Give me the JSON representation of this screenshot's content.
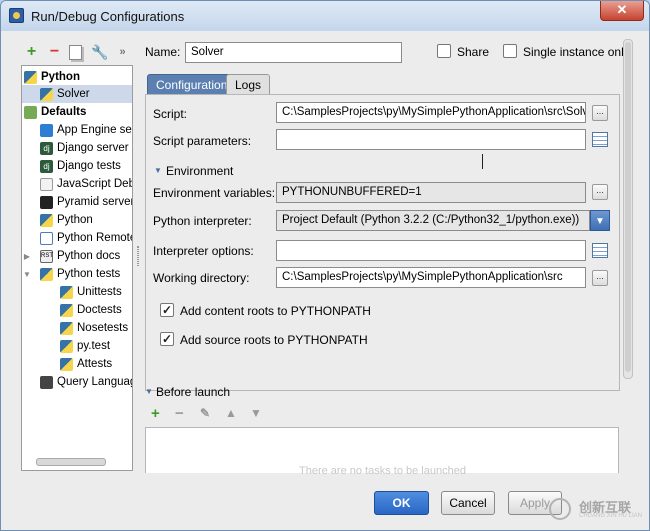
{
  "window": {
    "title": "Run/Debug Configurations",
    "close_label": "✕"
  },
  "toolbar": {
    "add": "+",
    "remove": "−",
    "more": "»"
  },
  "tree": {
    "python_group": "Python",
    "solver": "Solver",
    "defaults": "Defaults",
    "items": [
      "App Engine serv",
      "Django server",
      "Django tests",
      "JavaScript Debu",
      "Pyramid server",
      "Python",
      "Python Remote",
      "Python docs",
      "Python tests"
    ],
    "python_tests_children": [
      "Unittests",
      "Doctests",
      "Nosetests",
      "py.test",
      "Attests"
    ],
    "last": "Query Language"
  },
  "header": {
    "name_label": "Name:",
    "name_value": "Solver",
    "share_label": "Share",
    "single_instance_label": "Single instance only"
  },
  "tabs": {
    "configuration": "Configuration",
    "logs": "Logs"
  },
  "config": {
    "script_label": "Script:",
    "script_value": "C:\\SamplesProjects\\py\\MySimplePythonApplication\\src\\Solver.",
    "script_params_label": "Script parameters:",
    "script_params_value": "",
    "environment_section": "Environment",
    "env_vars_label": "Environment variables:",
    "env_vars_value": "PYTHONUNBUFFERED=1",
    "interpreter_label": "Python interpreter:",
    "interpreter_value": "Project Default (Python 3.2.2 (C:/Python32_1/python.exe))",
    "interp_options_label": "Interpreter options:",
    "interp_options_value": "",
    "working_dir_label": "Working directory:",
    "working_dir_value": "C:\\SamplesProjects\\py\\MySimplePythonApplication\\src",
    "content_roots_label": "Add content roots to PYTHONPATH",
    "source_roots_label": "Add source roots to PYTHONPATH",
    "ellipsis": "..."
  },
  "before_launch": {
    "label": "Before launch",
    "faded_text": "There are no tasks to be launched"
  },
  "buttons": {
    "ok": "OK",
    "cancel": "Cancel",
    "apply": "Apply"
  },
  "watermark": {
    "text": "创新互联",
    "sub": "CHUANG XIN HU LIAN"
  }
}
